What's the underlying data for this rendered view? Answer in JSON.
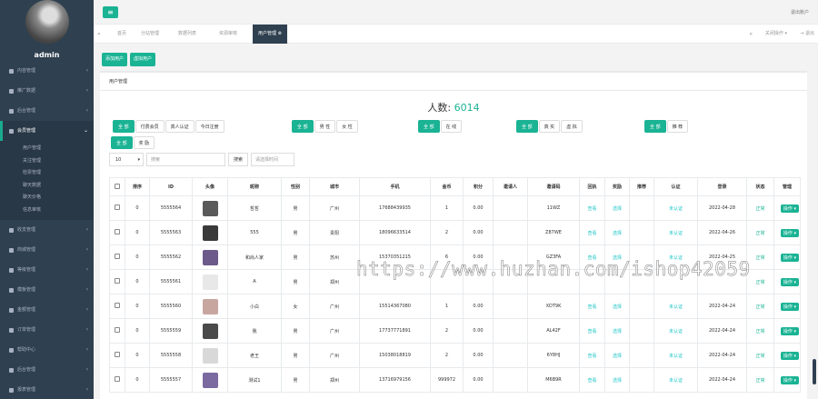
{
  "sidebar": {
    "username": "admin",
    "items": [
      {
        "label": "内容管理",
        "icon": "home-icon"
      },
      {
        "label": "推广数据",
        "icon": "chart-icon"
      },
      {
        "label": "后台管理",
        "icon": "users-icon"
      },
      {
        "label": "会员管理",
        "icon": "user-icon",
        "active": true
      },
      {
        "label": "收支管理",
        "icon": "money-icon"
      },
      {
        "label": "商城管理",
        "icon": "shop-icon"
      },
      {
        "label": "等级管理",
        "icon": "level-icon"
      },
      {
        "label": "模板管理",
        "icon": "template-icon"
      },
      {
        "label": "金额管理",
        "icon": "wallet-icon"
      },
      {
        "label": "订单管理",
        "icon": "order-icon"
      },
      {
        "label": "帮助中心",
        "icon": "help-icon"
      },
      {
        "label": "后台管理",
        "icon": "settings-icon"
      },
      {
        "label": "报表管理",
        "icon": "report-icon"
      }
    ],
    "submenu": [
      "用户管理",
      "关注管理",
      "检票管理",
      "聊天数据",
      "聊天价格",
      "信息审核"
    ]
  },
  "topbar": {
    "exit": "退出账户"
  },
  "tabs": {
    "items": [
      "首页",
      "分站管理",
      "数据列表",
      "资源审核",
      "用户管理"
    ],
    "ops": "关闭操作",
    "quit": "退出"
  },
  "actions": {
    "add": "添加用户",
    "virtual": "虚拟用户"
  },
  "panel": {
    "title": "用户管理",
    "count_label": "人数:",
    "count_value": "6014"
  },
  "filters": {
    "g1": [
      "全 部",
      "付费会员",
      "真人认证",
      "今日注册"
    ],
    "g2": [
      "全 部",
      "男 性",
      "女 性"
    ],
    "g3": [
      "全 部",
      "在 线"
    ],
    "g4": [
      "全 部",
      "真 实",
      "虚 拟"
    ],
    "g5": [
      "全 部",
      "推 荐"
    ],
    "g6": [
      "全 部",
      "奖 励"
    ]
  },
  "search": {
    "pagesize": "10",
    "placeholder": "搜索",
    "button": "搜索",
    "date_placeholder": "请选择时间"
  },
  "table": {
    "headers": [
      "",
      "排序",
      "ID",
      "头像",
      "昵称",
      "性别",
      "城市",
      "手机",
      "金币",
      "积分",
      "邀请人",
      "邀请码",
      "回执",
      "奖励",
      "推荐",
      "认证",
      "登录",
      "状态",
      "管理"
    ],
    "rows": [
      {
        "sort": "0",
        "id": "5555564",
        "nick": "哲哲",
        "sex": "男",
        "city": "广州",
        "phone": "17688439935",
        "coin": "1",
        "points": "0.00",
        "inviter": "",
        "code": "11WZ",
        "reply": "查看",
        "reward": "选择",
        "recommend": "",
        "auth": "未认证",
        "login": "2022-04-28",
        "status": "正常",
        "op": "操作"
      },
      {
        "sort": "0",
        "id": "5555563",
        "nick": "555",
        "sex": "男",
        "city": "贵阳",
        "phone": "18096633514",
        "coin": "2",
        "points": "0.00",
        "inviter": "",
        "code": "Z87WE",
        "reply": "查看",
        "reward": "选择",
        "recommend": "",
        "auth": "未认证",
        "login": "2022-04-26",
        "status": "正常",
        "op": "操作"
      },
      {
        "sort": "0",
        "id": "5555562",
        "nick": "和尚人家",
        "sex": "男",
        "city": "苏州",
        "phone": "15370351215",
        "coin": "6",
        "points": "0.00",
        "inviter": "",
        "code": "GZ3FA",
        "reply": "查看",
        "reward": "选择",
        "recommend": "",
        "auth": "未认证",
        "login": "2022-04-25",
        "status": "正常",
        "op": "操作"
      },
      {
        "sort": "0",
        "id": "5555561",
        "nick": "A",
        "sex": "男",
        "city": "郑州",
        "phone": "",
        "coin": "",
        "points": "",
        "inviter": "",
        "code": "",
        "reply": "",
        "reward": "",
        "recommend": "",
        "auth": "",
        "login": "",
        "status": "正常",
        "op": "操作"
      },
      {
        "sort": "0",
        "id": "5555560",
        "nick": "小白",
        "sex": "女",
        "city": "广州",
        "phone": "15514367080",
        "coin": "1",
        "points": "0.00",
        "inviter": "",
        "code": "XDT9K",
        "reply": "查看",
        "reward": "选择",
        "recommend": "",
        "auth": "未认证",
        "login": "2022-04-24",
        "status": "正常",
        "op": "操作"
      },
      {
        "sort": "0",
        "id": "5555559",
        "nick": "我",
        "sex": "男",
        "city": "广州",
        "phone": "17737771891",
        "coin": "2",
        "points": "0.00",
        "inviter": "",
        "code": "AL42F",
        "reply": "查看",
        "reward": "选择",
        "recommend": "",
        "auth": "未认证",
        "login": "2022-04-24",
        "status": "正常",
        "op": "操作"
      },
      {
        "sort": "0",
        "id": "5555558",
        "nick": "老王",
        "sex": "男",
        "city": "广州",
        "phone": "15038018819",
        "coin": "2",
        "points": "0.00",
        "inviter": "",
        "code": "6Y8HJ",
        "reply": "查看",
        "reward": "选择",
        "recommend": "",
        "auth": "未认证",
        "login": "2022-04-24",
        "status": "正常",
        "op": "操作"
      },
      {
        "sort": "0",
        "id": "5555557",
        "nick": "测试1",
        "sex": "男",
        "city": "郑州",
        "phone": "13716979156",
        "coin": "999972",
        "points": "0.00",
        "inviter": "",
        "code": "M6B9R",
        "reply": "查看",
        "reward": "选择",
        "recommend": "",
        "auth": "未认证",
        "login": "2022-04-24",
        "status": "正常",
        "op": "操作"
      }
    ]
  },
  "watermark": "https://www.huzhan.com/ishop42059"
}
